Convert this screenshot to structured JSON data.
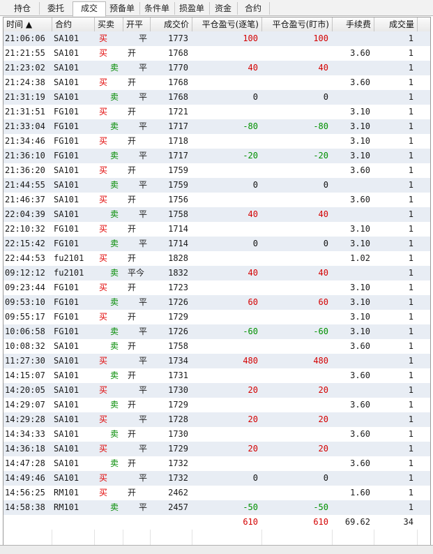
{
  "tabs": [
    {
      "label": "持仓",
      "active": false
    },
    {
      "label": "委托",
      "active": false
    },
    {
      "label": "成交",
      "active": true
    },
    {
      "label": "预备单",
      "active": false
    },
    {
      "label": "条件单",
      "active": false
    },
    {
      "label": "损盈单",
      "active": false
    },
    {
      "label": "资金",
      "active": false
    },
    {
      "label": "合约",
      "active": false
    }
  ],
  "headers": [
    "时间 ▲",
    "合约",
    "买卖",
    "开平",
    "成交价",
    "平仓盈亏(逐笔)",
    "平仓盈亏(盯市)",
    "手续费",
    "成交量"
  ],
  "rows": [
    {
      "time": "21:06:06",
      "contract": "SA101",
      "side": "买",
      "oc": "平",
      "price": "1773",
      "pl1": "100",
      "pl2": "100",
      "fee": "",
      "qty": "1"
    },
    {
      "time": "21:21:55",
      "contract": "SA101",
      "side": "买",
      "oc": "开",
      "price": "1768",
      "pl1": "",
      "pl2": "",
      "fee": "3.60",
      "qty": "1"
    },
    {
      "time": "21:23:02",
      "contract": "SA101",
      "side": "卖",
      "oc": "平",
      "price": "1770",
      "pl1": "40",
      "pl2": "40",
      "fee": "",
      "qty": "1"
    },
    {
      "time": "21:24:38",
      "contract": "SA101",
      "side": "买",
      "oc": "开",
      "price": "1768",
      "pl1": "",
      "pl2": "",
      "fee": "3.60",
      "qty": "1"
    },
    {
      "time": "21:31:19",
      "contract": "SA101",
      "side": "卖",
      "oc": "平",
      "price": "1768",
      "pl1": "0",
      "pl2": "0",
      "fee": "",
      "qty": "1"
    },
    {
      "time": "21:31:51",
      "contract": "FG101",
      "side": "买",
      "oc": "开",
      "price": "1721",
      "pl1": "",
      "pl2": "",
      "fee": "3.10",
      "qty": "1"
    },
    {
      "time": "21:33:04",
      "contract": "FG101",
      "side": "卖",
      "oc": "平",
      "price": "1717",
      "pl1": "-80",
      "pl2": "-80",
      "fee": "3.10",
      "qty": "1"
    },
    {
      "time": "21:34:46",
      "contract": "FG101",
      "side": "买",
      "oc": "开",
      "price": "1718",
      "pl1": "",
      "pl2": "",
      "fee": "3.10",
      "qty": "1"
    },
    {
      "time": "21:36:10",
      "contract": "FG101",
      "side": "卖",
      "oc": "平",
      "price": "1717",
      "pl1": "-20",
      "pl2": "-20",
      "fee": "3.10",
      "qty": "1"
    },
    {
      "time": "21:36:20",
      "contract": "SA101",
      "side": "买",
      "oc": "开",
      "price": "1759",
      "pl1": "",
      "pl2": "",
      "fee": "3.60",
      "qty": "1"
    },
    {
      "time": "21:44:55",
      "contract": "SA101",
      "side": "卖",
      "oc": "平",
      "price": "1759",
      "pl1": "0",
      "pl2": "0",
      "fee": "",
      "qty": "1"
    },
    {
      "time": "21:46:37",
      "contract": "SA101",
      "side": "买",
      "oc": "开",
      "price": "1756",
      "pl1": "",
      "pl2": "",
      "fee": "3.60",
      "qty": "1"
    },
    {
      "time": "22:04:39",
      "contract": "SA101",
      "side": "卖",
      "oc": "平",
      "price": "1758",
      "pl1": "40",
      "pl2": "40",
      "fee": "",
      "qty": "1"
    },
    {
      "time": "22:10:32",
      "contract": "FG101",
      "side": "买",
      "oc": "开",
      "price": "1714",
      "pl1": "",
      "pl2": "",
      "fee": "3.10",
      "qty": "1"
    },
    {
      "time": "22:15:42",
      "contract": "FG101",
      "side": "卖",
      "oc": "平",
      "price": "1714",
      "pl1": "0",
      "pl2": "0",
      "fee": "3.10",
      "qty": "1"
    },
    {
      "time": "22:44:53",
      "contract": "fu2101",
      "side": "买",
      "oc": "开",
      "price": "1828",
      "pl1": "",
      "pl2": "",
      "fee": "1.02",
      "qty": "1"
    },
    {
      "time": "09:12:12",
      "contract": "fu2101",
      "side": "卖",
      "oc": "平今",
      "price": "1832",
      "pl1": "40",
      "pl2": "40",
      "fee": "",
      "qty": "1"
    },
    {
      "time": "09:23:44",
      "contract": "FG101",
      "side": "买",
      "oc": "开",
      "price": "1723",
      "pl1": "",
      "pl2": "",
      "fee": "3.10",
      "qty": "1"
    },
    {
      "time": "09:53:10",
      "contract": "FG101",
      "side": "卖",
      "oc": "平",
      "price": "1726",
      "pl1": "60",
      "pl2": "60",
      "fee": "3.10",
      "qty": "1"
    },
    {
      "time": "09:55:17",
      "contract": "FG101",
      "side": "买",
      "oc": "开",
      "price": "1729",
      "pl1": "",
      "pl2": "",
      "fee": "3.10",
      "qty": "1"
    },
    {
      "time": "10:06:58",
      "contract": "FG101",
      "side": "卖",
      "oc": "平",
      "price": "1726",
      "pl1": "-60",
      "pl2": "-60",
      "fee": "3.10",
      "qty": "1"
    },
    {
      "time": "10:08:32",
      "contract": "SA101",
      "side": "卖",
      "oc": "开",
      "price": "1758",
      "pl1": "",
      "pl2": "",
      "fee": "3.60",
      "qty": "1"
    },
    {
      "time": "11:27:30",
      "contract": "SA101",
      "side": "买",
      "oc": "平",
      "price": "1734",
      "pl1": "480",
      "pl2": "480",
      "fee": "",
      "qty": "1"
    },
    {
      "time": "14:15:07",
      "contract": "SA101",
      "side": "卖",
      "oc": "开",
      "price": "1731",
      "pl1": "",
      "pl2": "",
      "fee": "3.60",
      "qty": "1"
    },
    {
      "time": "14:20:05",
      "contract": "SA101",
      "side": "买",
      "oc": "平",
      "price": "1730",
      "pl1": "20",
      "pl2": "20",
      "fee": "",
      "qty": "1"
    },
    {
      "time": "14:29:07",
      "contract": "SA101",
      "side": "卖",
      "oc": "开",
      "price": "1729",
      "pl1": "",
      "pl2": "",
      "fee": "3.60",
      "qty": "1"
    },
    {
      "time": "14:29:28",
      "contract": "SA101",
      "side": "买",
      "oc": "平",
      "price": "1728",
      "pl1": "20",
      "pl2": "20",
      "fee": "",
      "qty": "1"
    },
    {
      "time": "14:34:33",
      "contract": "SA101",
      "side": "卖",
      "oc": "开",
      "price": "1730",
      "pl1": "",
      "pl2": "",
      "fee": "3.60",
      "qty": "1"
    },
    {
      "time": "14:36:18",
      "contract": "SA101",
      "side": "买",
      "oc": "平",
      "price": "1729",
      "pl1": "20",
      "pl2": "20",
      "fee": "",
      "qty": "1"
    },
    {
      "time": "14:47:28",
      "contract": "SA101",
      "side": "卖",
      "oc": "开",
      "price": "1732",
      "pl1": "",
      "pl2": "",
      "fee": "3.60",
      "qty": "1"
    },
    {
      "time": "14:49:46",
      "contract": "SA101",
      "side": "买",
      "oc": "平",
      "price": "1732",
      "pl1": "0",
      "pl2": "0",
      "fee": "",
      "qty": "1"
    },
    {
      "time": "14:56:25",
      "contract": "RM101",
      "side": "买",
      "oc": "开",
      "price": "2462",
      "pl1": "",
      "pl2": "",
      "fee": "1.60",
      "qty": "1"
    },
    {
      "time": "14:58:38",
      "contract": "RM101",
      "side": "卖",
      "oc": "平",
      "price": "2457",
      "pl1": "-50",
      "pl2": "-50",
      "fee": "",
      "qty": "1"
    }
  ],
  "totals": {
    "pl1": "610",
    "pl2": "610",
    "fee": "69.62",
    "qty": "34"
  },
  "colors": {
    "buy": "#e00000",
    "sell": "#008a00",
    "profit": "#d40000",
    "loss": "#009000",
    "row_alt": "#e8edf4"
  }
}
